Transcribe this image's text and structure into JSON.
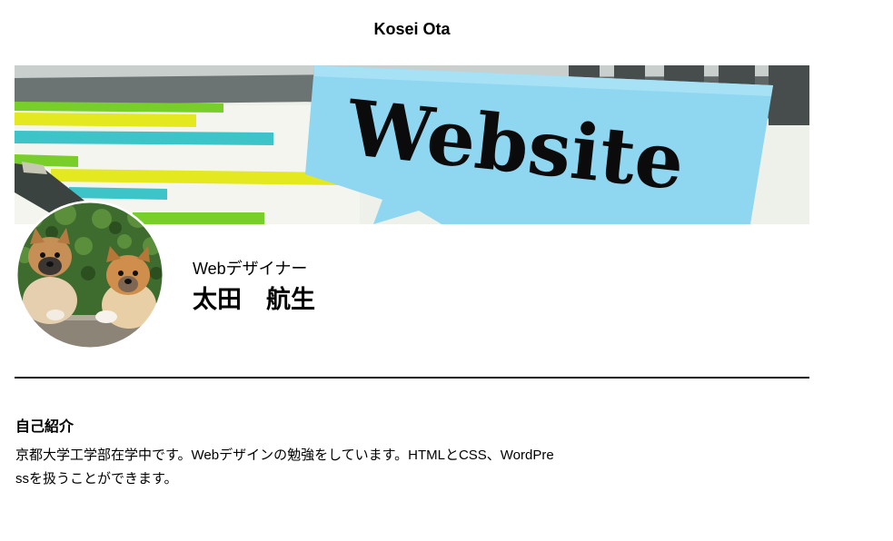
{
  "header": {
    "site_title": "Kosei Ota"
  },
  "banner": {
    "image_text": "Website",
    "icon": "website-banner-image",
    "colors": {
      "tag": "#8fd6f0",
      "keyboard": "#5f6665",
      "yellow": "#e4e81f",
      "cyan": "#3cc4c8",
      "green": "#79cf2a"
    }
  },
  "profile": {
    "avatar_icon": "shiba-puppies-avatar",
    "job_title": "Webデザイナー",
    "name": "太田　航生"
  },
  "about": {
    "heading": "自己紹介",
    "text": "京都大学工学部在学中です。Webデザインの勉強をしています。HTMLとCSS、WordPressを扱うことができます。"
  }
}
